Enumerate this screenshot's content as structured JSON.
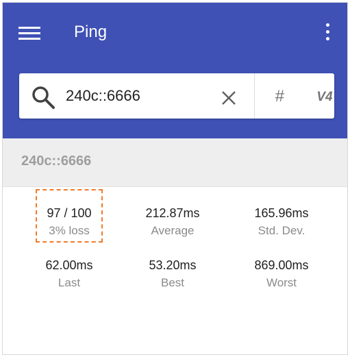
{
  "app": {
    "title": "Ping"
  },
  "search": {
    "value": "240c::6666",
    "hash_label": "#",
    "version_label": "V4"
  },
  "host": {
    "label": "240c::6666"
  },
  "stats": [
    {
      "value": "97 / 100",
      "label": "3% loss"
    },
    {
      "value": "212.87ms",
      "label": "Average"
    },
    {
      "value": "165.96ms",
      "label": "Std. Dev."
    },
    {
      "value": "62.00ms",
      "label": "Last"
    },
    {
      "value": "53.20ms",
      "label": "Best"
    },
    {
      "value": "869.00ms",
      "label": "Worst"
    }
  ],
  "colors": {
    "primary": "#3f51b5",
    "highlight": "#f07a2a"
  },
  "icons": [
    "menu-icon",
    "more-vert-icon",
    "search-icon",
    "clear-icon"
  ]
}
